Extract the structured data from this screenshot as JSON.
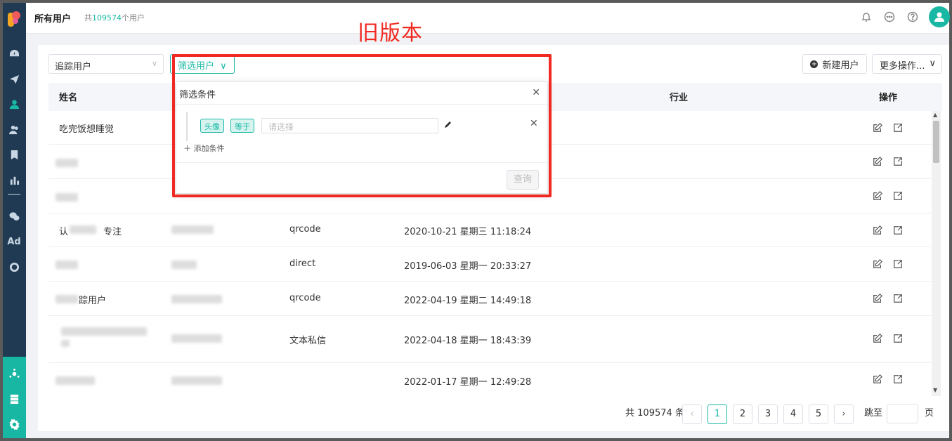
{
  "header": {
    "title": "所有用户",
    "count_prefix": "共",
    "count_value": "109574",
    "count_suffix": "个用户"
  },
  "annotation": "旧版本",
  "toolbar": {
    "track_select": "追踪用户",
    "filter_button": "筛选用户",
    "new_user": "新建用户",
    "more_actions": "更多操作..."
  },
  "table": {
    "columns": [
      "姓名",
      "行业",
      "操作"
    ],
    "rows": [
      {
        "name": "吃完饭想睡觉",
        "source": "",
        "time": ""
      },
      {
        "name": "",
        "source": "",
        "time": ""
      },
      {
        "name": "",
        "source": "",
        "time": ""
      },
      {
        "name_a": "认",
        "name_b": "专注",
        "source": "qrcode",
        "time": "2020-10-21 星期三 11:18:24"
      },
      {
        "name": "",
        "source": "direct",
        "time": "2019-06-03 星期一 20:33:27"
      },
      {
        "name": "踪用户",
        "source": "qrcode",
        "time": "2022-04-19 星期二 14:49:18"
      },
      {
        "name": "",
        "source": "文本私信",
        "time": "2022-04-18 星期一 18:43:39"
      },
      {
        "name": "",
        "source": "",
        "time": "2022-01-17 星期一 12:49:28"
      }
    ]
  },
  "filter_popover": {
    "title": "筛选条件",
    "field_tag": "头像",
    "operator_tag": "等于",
    "value_placeholder": "请选择",
    "add_condition": "添加条件",
    "query_button": "查询"
  },
  "pagination": {
    "total_prefix": "共",
    "total": "109574",
    "total_suffix": "条",
    "pages": [
      "1",
      "2",
      "3",
      "4",
      "5"
    ],
    "current": "1",
    "jump_label": "跳至",
    "page_suffix": "页"
  },
  "colors": {
    "brand": "#19b8a5",
    "sidebar": "#1f3a52",
    "annotation_red": "#f02a22"
  }
}
